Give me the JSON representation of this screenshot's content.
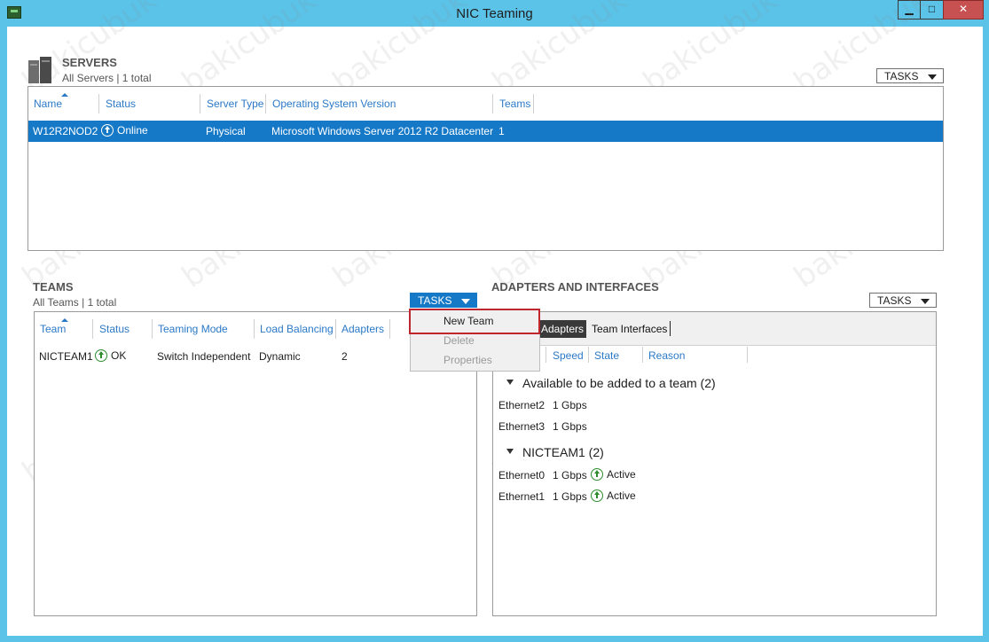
{
  "window": {
    "title": "NIC Teaming",
    "min_label": "▁",
    "max_label": "□",
    "close_label": "✕",
    "icon": "nic-teaming-app-icon",
    "close_color": "#c75050",
    "titlebar_color": "#5bc3e8"
  },
  "watermark_text": "bakicubuk",
  "servers": {
    "title": "SERVERS",
    "subtitle": "All Servers | 1 total",
    "tasks_label": "TASKS",
    "columns": [
      "Name",
      "Status",
      "Server Type",
      "Operating System Version",
      "Teams"
    ],
    "rows": [
      {
        "name": "W12R2NOD2",
        "status": "Online",
        "server_type": "Physical",
        "os_version": "Microsoft Windows Server 2012 R2 Datacenter",
        "teams": "1"
      }
    ],
    "selected_row_color": "#1679c7"
  },
  "teams": {
    "title": "TEAMS",
    "subtitle": "All Teams | 1 total",
    "tasks_label": "TASKS",
    "columns": [
      "Team",
      "Status",
      "Teaming Mode",
      "Load Balancing",
      "Adapters"
    ],
    "rows": [
      {
        "team": "NICTEAM1",
        "status": "OK",
        "mode": "Switch Independent",
        "load_balancing": "Dynamic",
        "adapters": "2"
      }
    ],
    "tasks_menu": {
      "items": [
        {
          "label": "New Team",
          "enabled": true
        },
        {
          "label": "Delete",
          "enabled": false
        },
        {
          "label": "Properties",
          "enabled": false
        }
      ],
      "highlight_color": "#c0262e"
    }
  },
  "adapters": {
    "title": "ADAPTERS AND INTERFACES",
    "tasks_label": "TASKS",
    "tabs": [
      "Adapters",
      "Team Interfaces"
    ],
    "active_tab": "Adapters",
    "columns": [
      "Speed",
      "State",
      "Reason"
    ],
    "groups": [
      {
        "label": "Available to be added to a team (2)",
        "items": [
          {
            "name": "Ethernet2",
            "speed": "1 Gbps",
            "state": ""
          },
          {
            "name": "Ethernet3",
            "speed": "1 Gbps",
            "state": ""
          }
        ]
      },
      {
        "label": "NICTEAM1 (2)",
        "items": [
          {
            "name": "Ethernet0",
            "speed": "1 Gbps",
            "state": "Active"
          },
          {
            "name": "Ethernet1",
            "speed": "1 Gbps",
            "state": "Active"
          }
        ]
      }
    ]
  },
  "colors": {
    "accent": "#1679c7",
    "header_text": "#2b79c7",
    "status_ok": "#2e8b2e"
  }
}
